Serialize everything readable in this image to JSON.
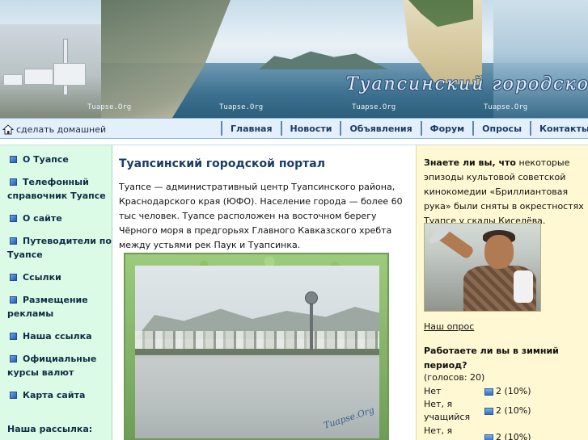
{
  "banner": {
    "site_title": "Туапсинский городской п",
    "watermarks": [
      "Tuapse.Org",
      "Tuapse.Org",
      "Tuapse.Org",
      "Tuapse.Org"
    ]
  },
  "nav": {
    "home_link": "сделать домашней",
    "home_icon": "house-icon",
    "items": [
      "Главная",
      "Новости",
      "Объявления",
      "Форум",
      "Опросы",
      "Контакты"
    ]
  },
  "sidebar": {
    "items": [
      {
        "label": "О Туапсе"
      },
      {
        "label": "Телефонный справочник Туапсе"
      },
      {
        "label": "О сайте"
      },
      {
        "label": "Путеводители по Туапсе"
      },
      {
        "label": "Ссылки"
      },
      {
        "label": "Размещение рекламы"
      },
      {
        "label": "Наша ссылка"
      },
      {
        "label": "Официальные курсы валют"
      },
      {
        "label": "Карта сайта"
      }
    ],
    "newsletter": "Наша рассылка:"
  },
  "main": {
    "title": "Туапсинский городской портал",
    "intro": "Туапсе — административный центр Туапсинского района, Краснодарского края (ЮФО). Население города — более 60 тыс человек. Туапсе расположен на восточном берегу Чёрного моря в предгорьях Главного Кавказского хребта между устьями рек Паук и Туапсинка.",
    "photo_watermark": "Tuapse.Org"
  },
  "right": {
    "fact_lead": "Знаете ли вы, что",
    "fact_text": " некоторые эпизоды культовой советской кинокомедии «Бриллиантовая рука» были сняты в окрестностях Туапсе у скалы Киселёва.",
    "poll_link": "Наш опрос",
    "poll_question": "Работаете ли вы в зимний период?",
    "poll_votes": "(голосов: 20)",
    "poll_answers": [
      {
        "answer": "Нет",
        "result": "2 (10%)"
      },
      {
        "answer": "Нет, я учащийся",
        "result": "2 (10%)"
      },
      {
        "answer": "Нет, я",
        "result": "2 (10%)"
      }
    ]
  },
  "colors": {
    "nav_bg": "#e3f0fb",
    "left_bg": "#dcfbe6",
    "right_bg": "#fff8d2",
    "title_color": "#1b3b66"
  }
}
